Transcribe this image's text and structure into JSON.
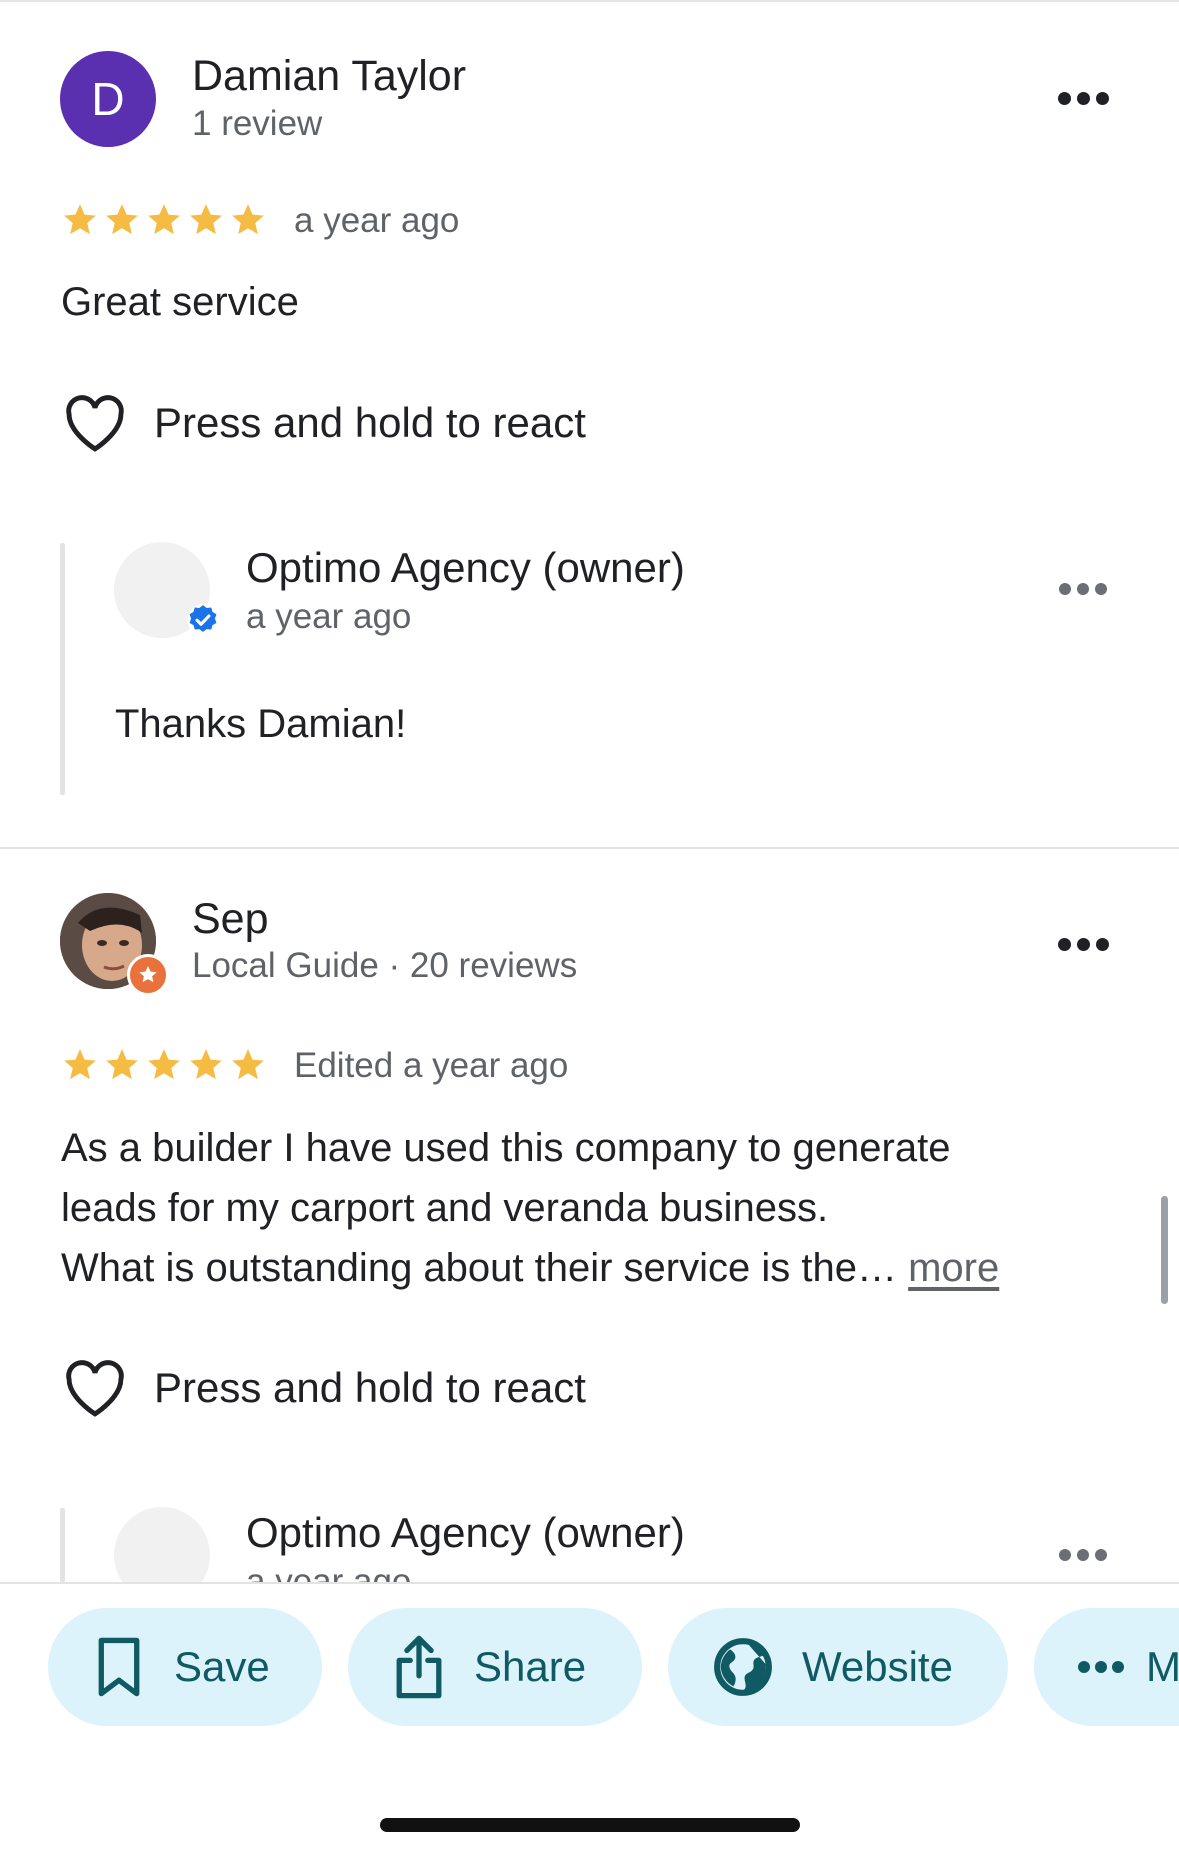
{
  "reviews": [
    {
      "avatar_letter": "D",
      "name": "Damian Taylor",
      "meta": "1 review",
      "rating": 5,
      "time": "a year ago",
      "text": "Great service",
      "react_label": "Press and hold to react",
      "reply": {
        "name": "Optimo Agency (owner)",
        "time": "a year ago",
        "text": "Thanks Damian!"
      }
    },
    {
      "name": "Sep",
      "meta": "Local Guide · 20 reviews",
      "rating": 5,
      "time": "Edited a year ago",
      "text_lines": [
        "As a builder I have used this company to generate",
        "leads for my carport and veranda business.",
        "What is outstanding about their service is the…"
      ],
      "more_label": "more",
      "react_label": "Press and hold to react",
      "reply": {
        "name": "Optimo Agency (owner)",
        "time": "a year ago"
      }
    }
  ],
  "actions": {
    "save": "Save",
    "share": "Share",
    "website": "Website",
    "more": "M"
  },
  "colors": {
    "avatar_purple": "#5a2fb0",
    "star": "#f6bb42",
    "chip_bg": "#dcf3fb",
    "chip_text": "#0f5a63",
    "verified": "#1a73e8",
    "local_guide": "#e8713c"
  }
}
